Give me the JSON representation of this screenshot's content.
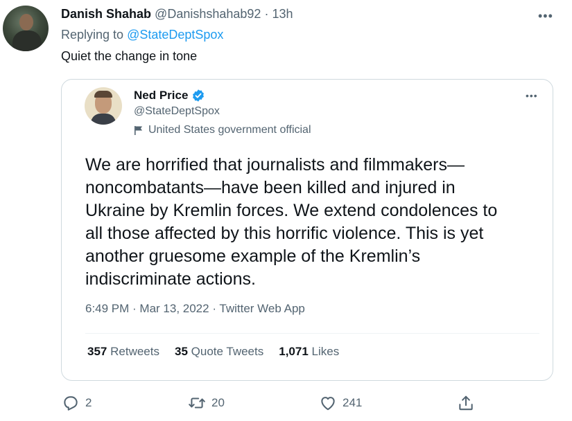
{
  "outer": {
    "name": "Danish Shahab",
    "handle": "@Danishshahab92",
    "separator": "·",
    "time": "13h",
    "replying_prefix": "Replying to",
    "replying_to": "@StateDeptSpox",
    "text": "Quiet the change in tone"
  },
  "quoted": {
    "name": "Ned Price",
    "handle": "@StateDeptSpox",
    "label": "United States government official",
    "body_lines": [
      "We are horrified that journalists and filmmakers—",
      "noncombatants—have been killed and injured in",
      "Ukraine by Kremlin forces. We extend condolences to",
      "all those affected by this horrific violence. This is yet",
      "another gruesome example of the Kremlin’s",
      "indiscriminate actions."
    ],
    "meta": "6:49 PM · Mar 13, 2022 · Twitter Web App",
    "stats": {
      "retweets_count": "357",
      "retweets_label": "Retweets",
      "quotes_count": "35",
      "quotes_label": "Quote Tweets",
      "likes_count": "1,071",
      "likes_label": "Likes"
    }
  },
  "actions": {
    "reply_count": "2",
    "retweet_count": "20",
    "like_count": "241"
  },
  "icons": {
    "more": "more-icon",
    "verified": "verified-badge-icon",
    "official": "flag-icon",
    "reply": "reply-icon",
    "retweet": "retweet-icon",
    "like": "heart-icon",
    "share": "share-icon"
  },
  "colors": {
    "accent": "#1d9bf0",
    "text": "#0f1419",
    "muted": "#536471",
    "border": "#cfd9de"
  }
}
